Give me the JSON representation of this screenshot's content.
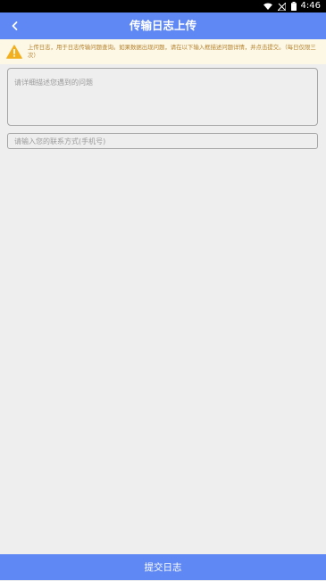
{
  "status_bar": {
    "time": "4:46",
    "icons": [
      "wifi-icon",
      "no-signal-icon",
      "battery-icon"
    ]
  },
  "header": {
    "title": "传输日志上传",
    "back_icon": "chevron-left-icon"
  },
  "notice": {
    "icon": "warning-icon",
    "text": "上传日志，用于日志传输问题查询。如果数据出现问题，请在以下输入框描述问题详情，并点击提交。（每日仅限三次）"
  },
  "form": {
    "description_placeholder": "请详细描述您遇到的问题",
    "description_value": "",
    "contact_placeholder": "请输入您的联系方式(手机号)",
    "contact_value": ""
  },
  "footer": {
    "submit_label": "提交日志"
  },
  "colors": {
    "primary": "#5f88f4",
    "notice_bg": "#fdf7e6",
    "notice_text": "#b5842e",
    "warning_icon": "#f2b01e",
    "page_bg": "#eeeeee"
  }
}
